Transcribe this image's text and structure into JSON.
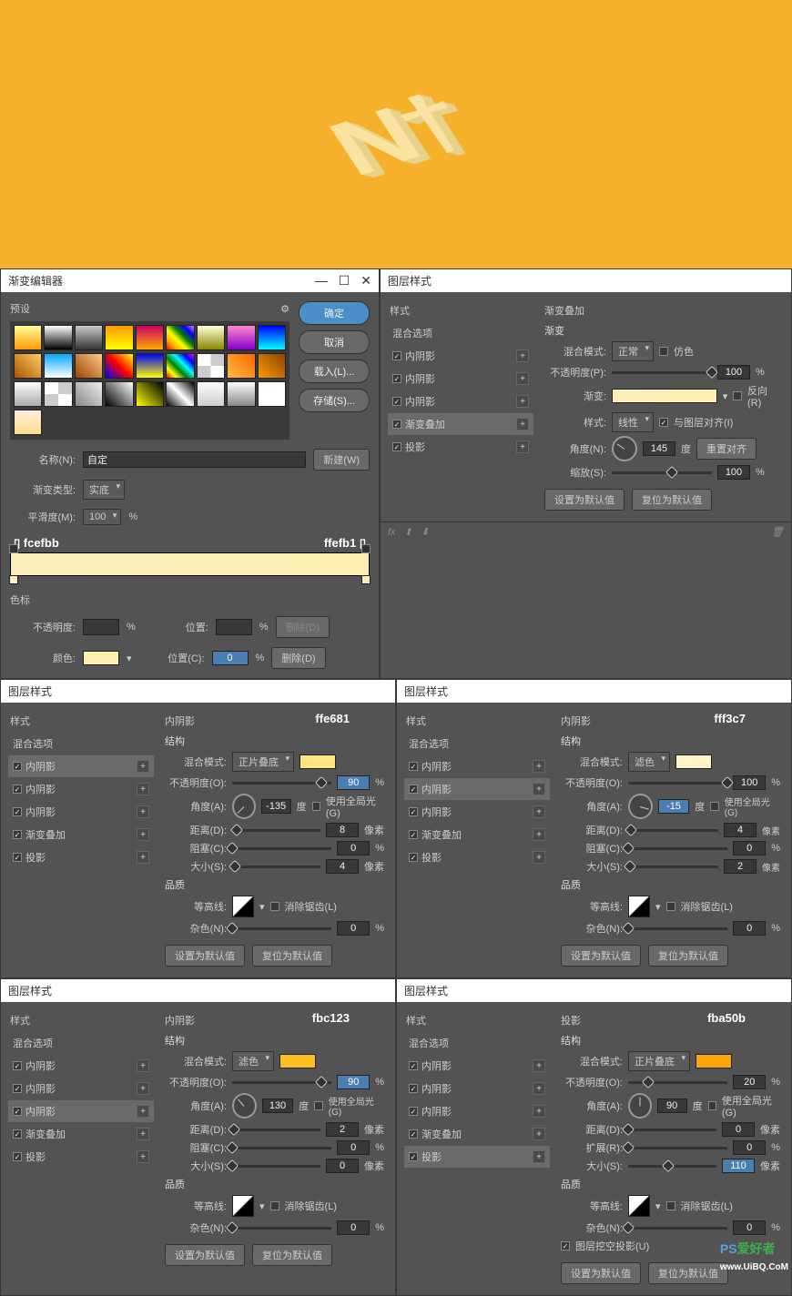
{
  "hero_text": "N†",
  "gradient_editor": {
    "title": "渐变编辑器",
    "preset_label": "预设",
    "buttons": {
      "ok": "确定",
      "cancel": "取消",
      "load": "载入(L)...",
      "save": "存储(S)..."
    },
    "name_label": "名称(N):",
    "name_value": "自定",
    "new_btn": "新建(W)",
    "type_label": "渐变类型:",
    "type_value": "实底",
    "smooth_label": "平滑度(M):",
    "smooth_value": "100",
    "smooth_unit": "%",
    "stop_left": "fcefbb",
    "stop_right": "ffefb1",
    "stops_title": "色标",
    "opacity_label": "不透明度:",
    "pos_label": "位置:",
    "pos_label2": "位置(C):",
    "pos_value": "0",
    "color_label": "颜色:",
    "delete_btn": "删除(D)",
    "unit": "%"
  },
  "layer_style_title": "图层样式",
  "common": {
    "styles": "样式",
    "blend_options": "混合选项",
    "inner_shadow": "内阴影",
    "gradient_overlay": "渐变叠加",
    "drop_shadow": "投影",
    "structure": "结构",
    "quality": "品质",
    "blend_mode": "混合模式:",
    "opacity": "不透明度(O):",
    "opacity_p": "不透明度(P):",
    "angle": "角度(A):",
    "angle_n": "角度(N):",
    "deg": "度",
    "global_light": "使用全局光(G)",
    "distance": "距离(D):",
    "choke": "阻塞(C):",
    "spread": "扩展(R):",
    "size": "大小(S):",
    "px": "像素",
    "pct": "%",
    "contour": "等高线:",
    "antialias": "消除锯齿(L)",
    "noise": "杂色(N):",
    "set_default": "设置为默认值",
    "reset_default": "复位为默认值",
    "gradient": "渐变:",
    "reverse": "反向(R)",
    "style": "样式:",
    "align": "与图层对齐(I)",
    "reset_align": "重置对齐",
    "scale": "缩放(S):",
    "dither": "仿色",
    "linear": "线性",
    "normal": "正常",
    "multiply": "正片叠底",
    "screen": "滤色",
    "knockout": "图层挖空投影(U)"
  },
  "panel_go": {
    "title": "渐变叠加",
    "sub": "渐变",
    "opacity": "100",
    "angle": "145",
    "scale": "100"
  },
  "panel_is1": {
    "color": "ffe681",
    "opacity": "90",
    "angle": "-135",
    "dist": "8",
    "choke": "0",
    "size": "4",
    "noise": "0"
  },
  "panel_is2": {
    "color": "fff3c7",
    "opacity": "100",
    "angle": "-15",
    "dist": "4",
    "choke": "0",
    "size": "2",
    "noise": "0"
  },
  "panel_is3": {
    "color": "fbc123",
    "opacity": "90",
    "angle": "130",
    "dist": "2",
    "choke": "0",
    "size": "0",
    "noise": "0"
  },
  "panel_ds": {
    "color": "fba50b",
    "opacity": "20",
    "angle": "90",
    "dist": "0",
    "spread": "0",
    "size": "110",
    "noise": "0"
  },
  "watermark": {
    "a": "PS",
    "b": "爱好者",
    "c": "www.UiBQ.CoM"
  }
}
